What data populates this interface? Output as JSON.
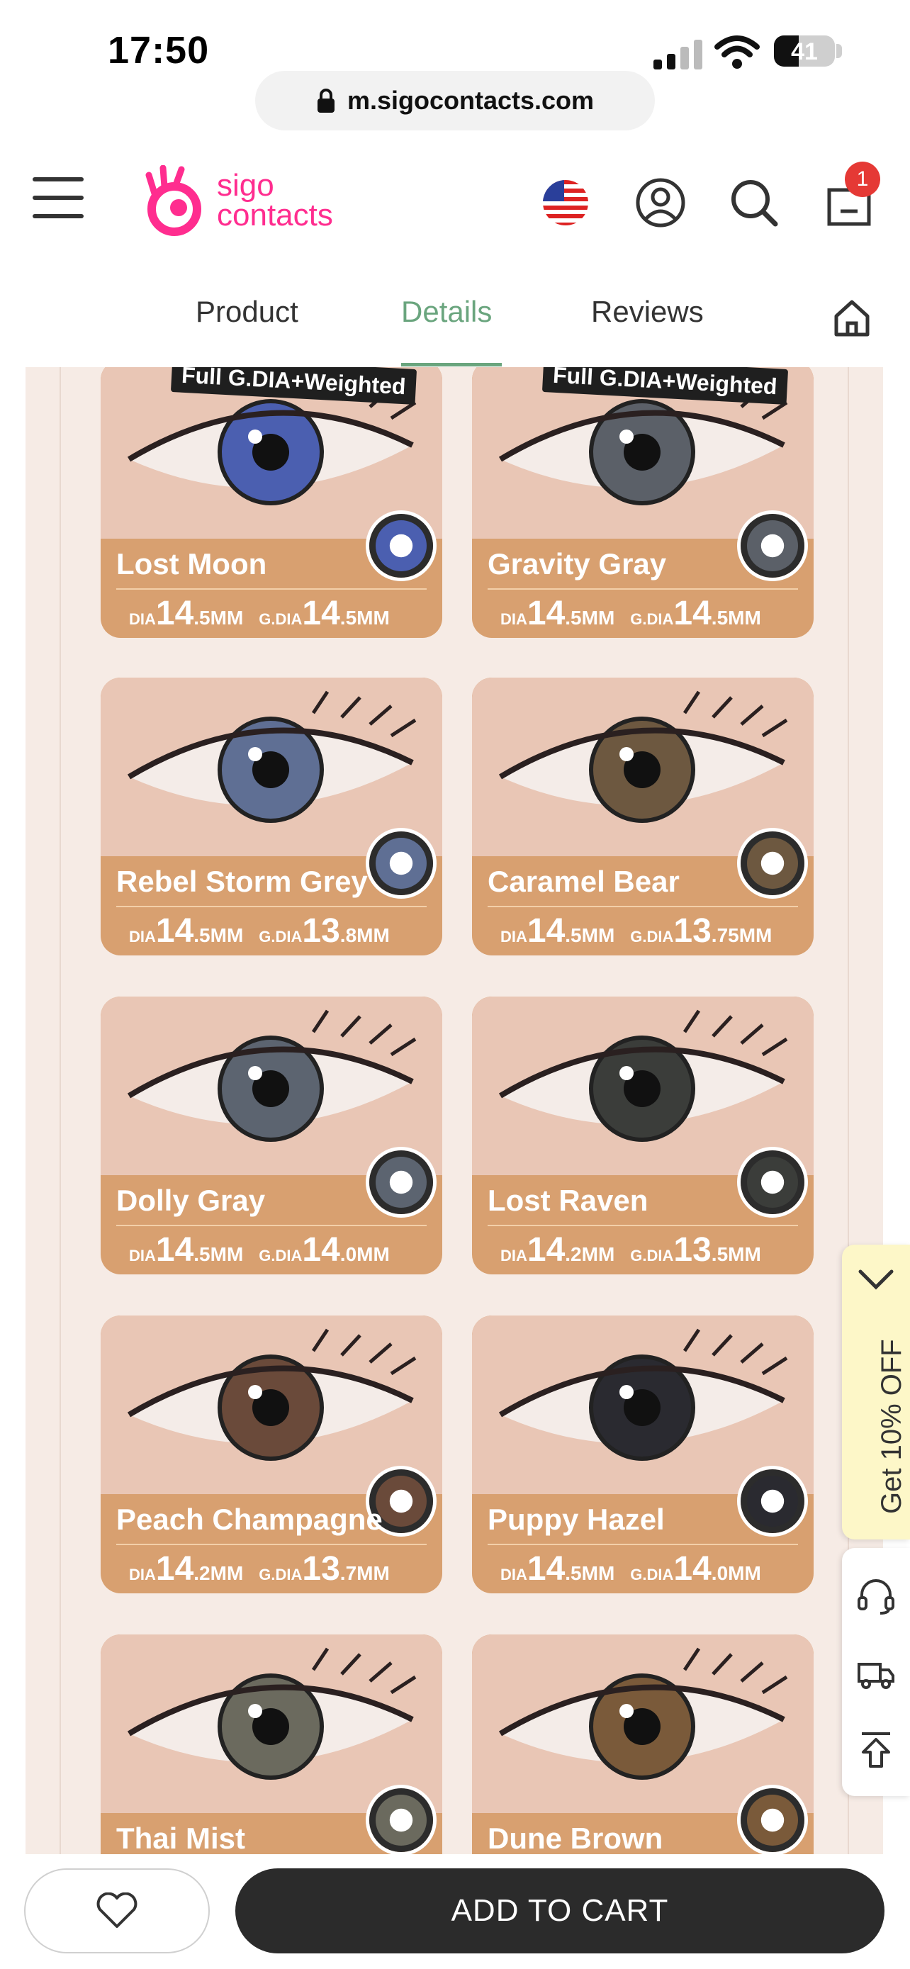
{
  "status_bar": {
    "time": "17:50",
    "battery": "41",
    "battery_level": 0.41
  },
  "browser": {
    "url": "m.sigocontacts.com"
  },
  "header": {
    "logo_line1": "sigo",
    "logo_line2": "contacts",
    "cart_count": "1",
    "brand_color": "#ff2d8f",
    "icons": [
      "menu-icon",
      "us-flag-icon",
      "account-icon",
      "search-icon",
      "cart-icon"
    ]
  },
  "tabs": {
    "items": [
      "Product",
      "Details",
      "Reviews"
    ],
    "active": "Details",
    "active_color": "#6aa57e"
  },
  "products": [
    {
      "name": "Lost Moon",
      "dia": "14",
      "dia_unit": ".5MM",
      "gdia": "14",
      "gdia_unit": ".5MM",
      "badge": "Full G.DIA+Weighted",
      "iris": "#4b5fb0"
    },
    {
      "name": "Gravity Gray",
      "dia": "14",
      "dia_unit": ".5MM",
      "gdia": "14",
      "gdia_unit": ".5MM",
      "badge": "Full G.DIA+Weighted",
      "iris": "#5b6068"
    },
    {
      "name": "Rebel Storm Grey",
      "dia": "14",
      "dia_unit": ".5MM",
      "gdia": "13",
      "gdia_unit": ".8MM",
      "badge": "",
      "iris": "#5f6f94"
    },
    {
      "name": "Caramel Bear",
      "dia": "14",
      "dia_unit": ".5MM",
      "gdia": "13",
      "gdia_unit": ".75MM",
      "badge": "",
      "iris": "#6d5840"
    },
    {
      "name": "Dolly Gray",
      "dia": "14",
      "dia_unit": ".5MM",
      "gdia": "14",
      "gdia_unit": ".0MM",
      "badge": "",
      "iris": "#5c6470"
    },
    {
      "name": "Lost Raven",
      "dia": "14",
      "dia_unit": ".2MM",
      "gdia": "13",
      "gdia_unit": ".5MM",
      "badge": "",
      "iris": "#3b3d3a"
    },
    {
      "name": "Peach Champagne",
      "dia": "14",
      "dia_unit": ".2MM",
      "gdia": "13",
      "gdia_unit": ".7MM",
      "badge": "",
      "iris": "#6a4a3a"
    },
    {
      "name": "Puppy Hazel",
      "dia": "14",
      "dia_unit": ".5MM",
      "gdia": "14",
      "gdia_unit": ".0MM",
      "badge": "",
      "iris": "#2a2a30"
    },
    {
      "name": "Thai Mist",
      "dia": "",
      "dia_unit": "",
      "gdia": "",
      "gdia_unit": "",
      "badge": "",
      "iris": "#6b6a5e"
    },
    {
      "name": "Dune Brown",
      "dia": "",
      "dia_unit": "",
      "gdia": "",
      "gdia_unit": "",
      "badge": "",
      "iris": "#7a5a3a"
    }
  ],
  "spec_labels": {
    "dia": "DIA",
    "gdia": "G.DIA"
  },
  "side_widget": {
    "promo_text": "Get 10% OFF",
    "icons": [
      "chevron-down-icon",
      "headset-icon",
      "delivery-truck-icon",
      "back-to-top-icon"
    ]
  },
  "bottom_bar": {
    "add_to_cart": "ADD TO CART",
    "wishlist_icon": "heart-icon"
  }
}
